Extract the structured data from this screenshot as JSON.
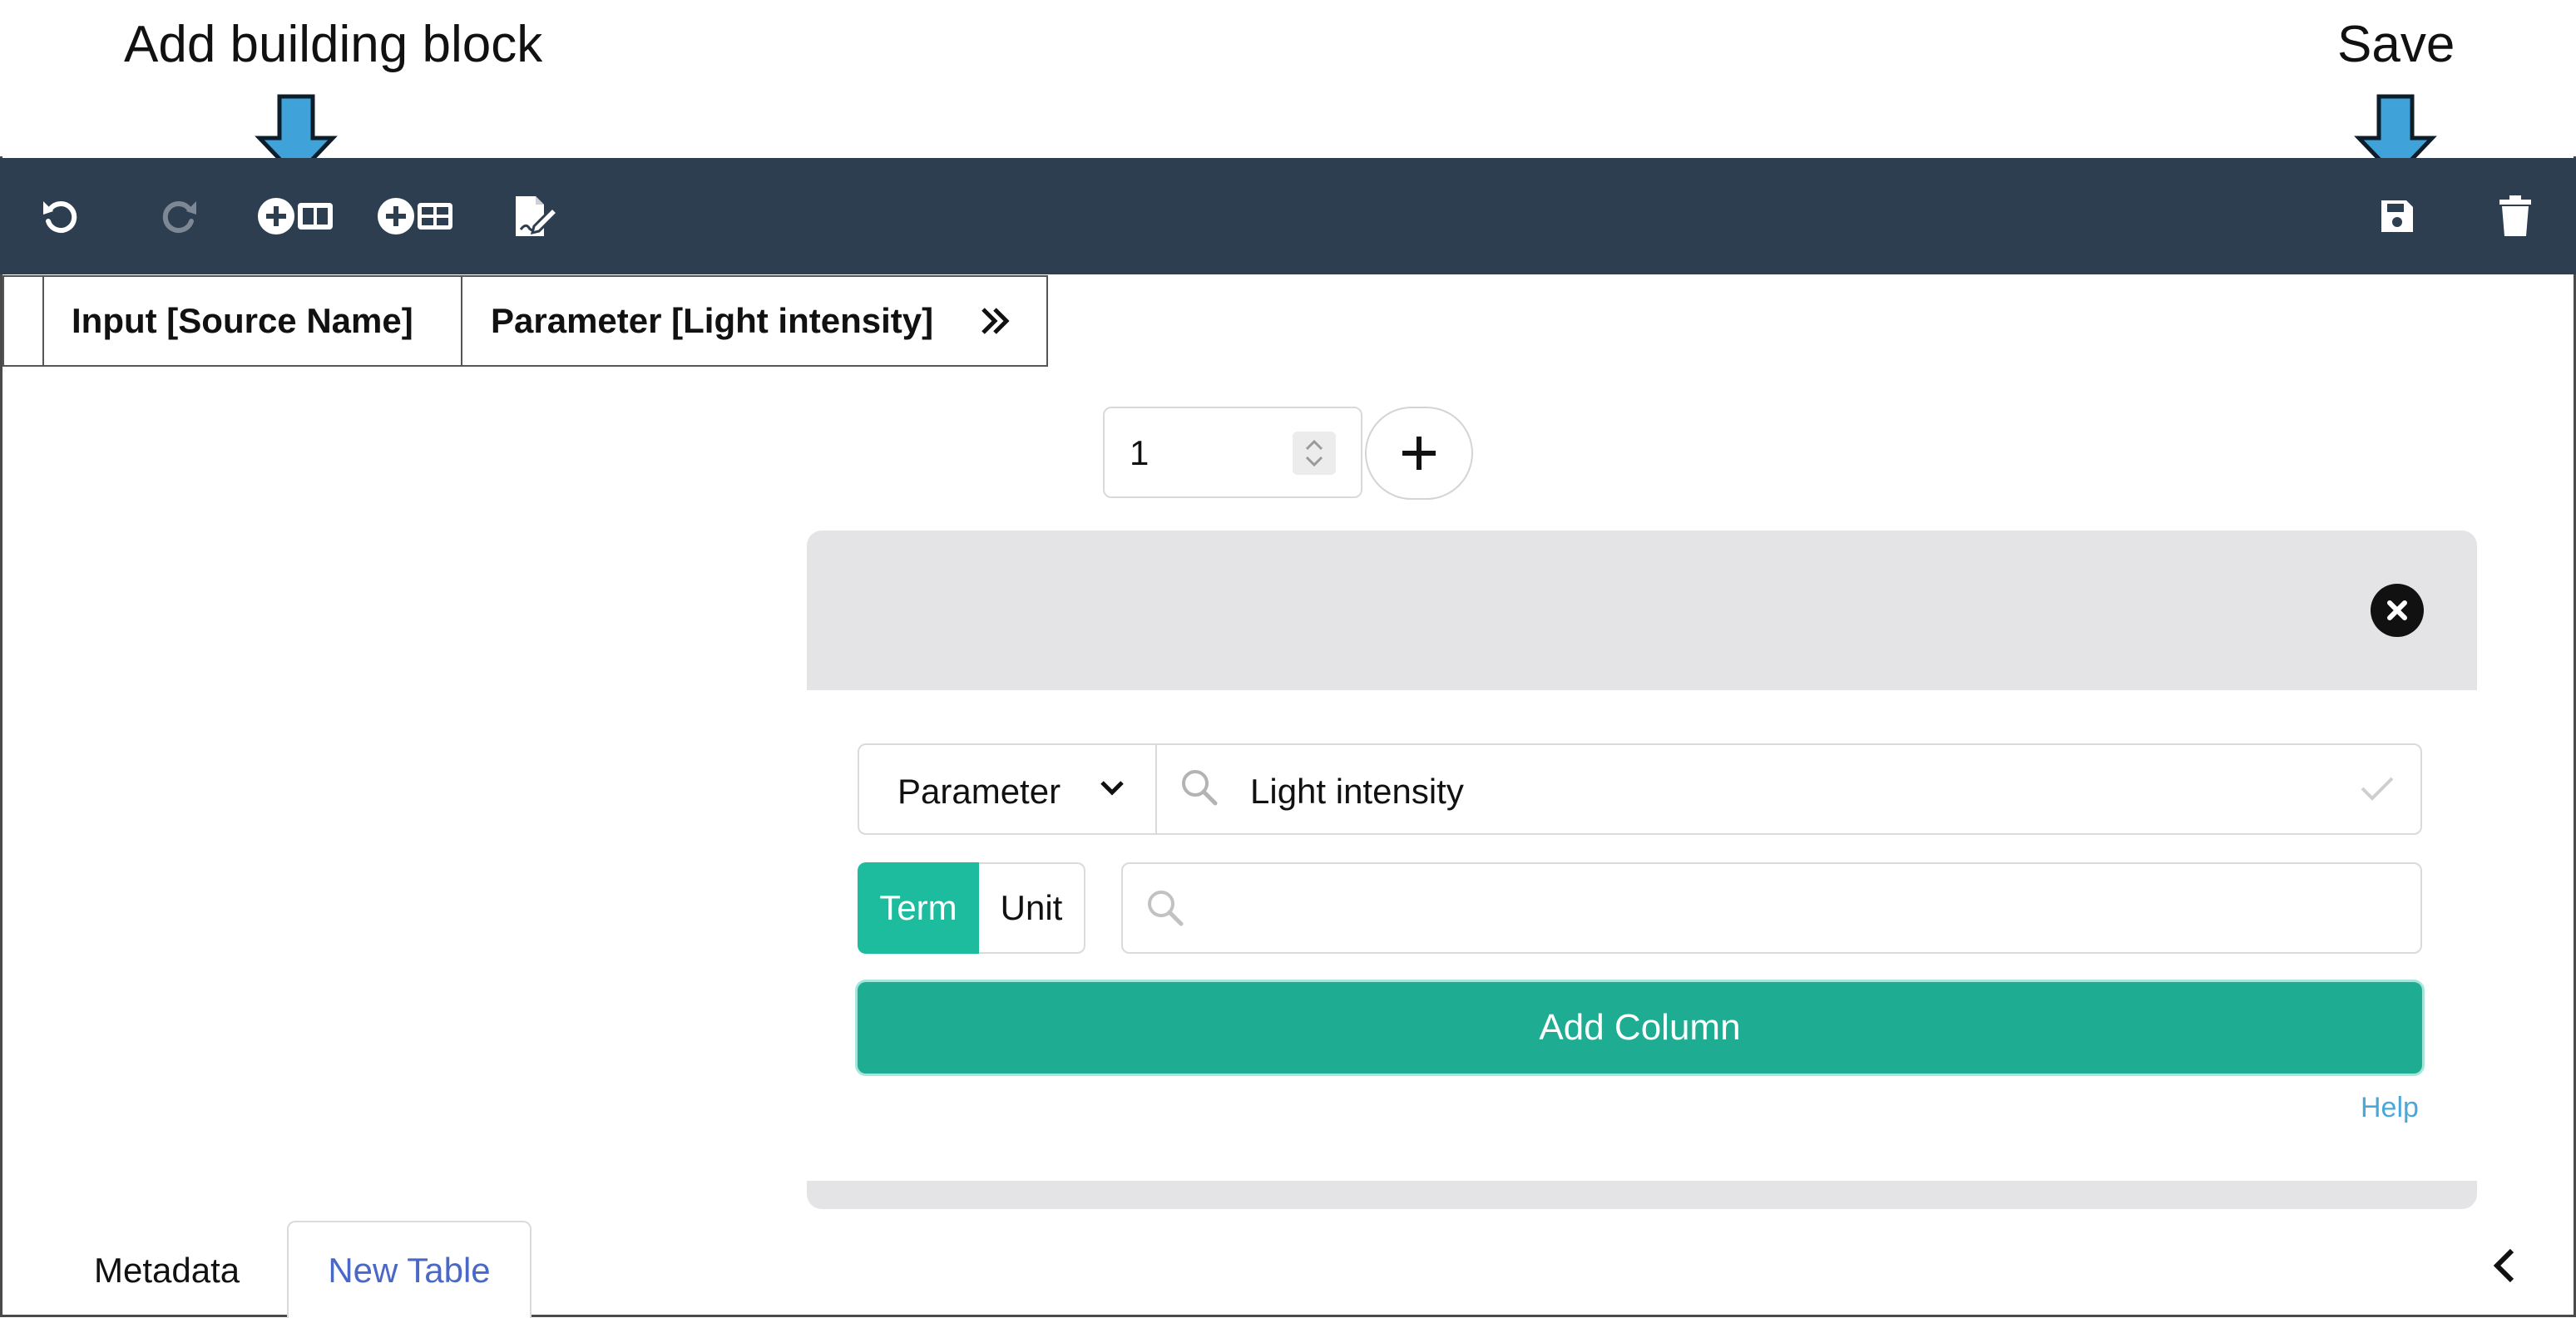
{
  "annotations": {
    "add_building_block": "Add building block",
    "save": "Save",
    "arrow_color": "#3fa3d9"
  },
  "toolbar": {
    "background": "#2d3e50",
    "icons": [
      "undo-icon",
      "redo-icon",
      "add-building-block-icon",
      "add-template-icon",
      "edit-metadata-icon",
      "save-icon",
      "trash-icon"
    ]
  },
  "table": {
    "headers": [
      "Input [Source Name]",
      "Parameter [Light intensity]"
    ],
    "expand_icon": "double-chevron-right-icon"
  },
  "row_count": {
    "value": "1",
    "add_icon": "plus-icon"
  },
  "building_block": {
    "type_select": "Parameter",
    "term_value": "Light intensity",
    "term_toggle": [
      "Term",
      "Unit"
    ],
    "active_toggle": "Term",
    "unit_search_value": "",
    "add_button": "Add Column",
    "help": "Help",
    "accent_color": "#1ead92"
  },
  "bottom_tabs": {
    "items": [
      "Metadata",
      "New Table"
    ],
    "active": "New Table",
    "collapse_icon": "chevron-left-icon"
  }
}
